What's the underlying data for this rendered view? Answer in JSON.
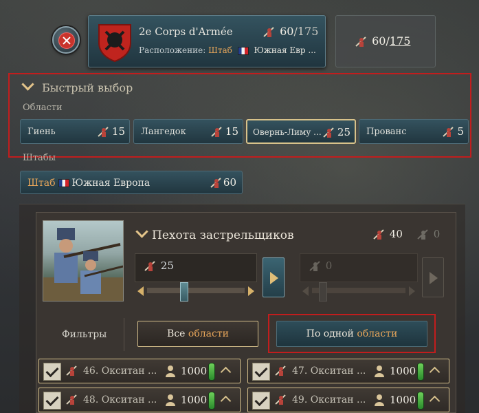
{
  "header": {
    "corps_name": "2e Corps d'Armée",
    "location_label": "Расположение:",
    "location_hq": "Штаб",
    "location_place": "Южная Евр ...",
    "count_current": "60",
    "count_max": "/175",
    "total_current": "60",
    "total_max": "175",
    "close_icon": "close-icon"
  },
  "quick_select": {
    "title": "Быстрый выбор",
    "regions_label": "Области",
    "regions": [
      {
        "label": "Гиень",
        "count": "15"
      },
      {
        "label": "Лангедок",
        "count": "15"
      },
      {
        "label": "Овернь-Лиму ...",
        "count": "25"
      },
      {
        "label": "Прованс",
        "count": "5"
      }
    ],
    "hq_label": "Штабы",
    "hq_button": {
      "prefix": "Штаб",
      "place": "Южная Европа",
      "count": "60"
    }
  },
  "unit": {
    "title": "Пехота застрельщиков",
    "count_active": "40",
    "count_inactive": "0",
    "slider_left_value": "25",
    "slider_left_fraction": 0.36,
    "slider_right_value": "0",
    "slider_right_fraction": 0.08
  },
  "filters": {
    "label": "Фильтры",
    "all_prefix": "Все",
    "all_accent": "области",
    "one_prefix": "По одной",
    "one_accent": "области"
  },
  "divisions": [
    {
      "name": "46. Окситан ...",
      "count": "1000"
    },
    {
      "name": "47. Окситан ...",
      "count": "1000"
    },
    {
      "name": "48. Окситан ...",
      "count": "1000"
    },
    {
      "name": "49. Окситан ...",
      "count": "1000"
    }
  ],
  "colors": {
    "accent": "#e8a65a",
    "gold_border": "#d6c08c",
    "highlight_red": "#c21d1d"
  }
}
